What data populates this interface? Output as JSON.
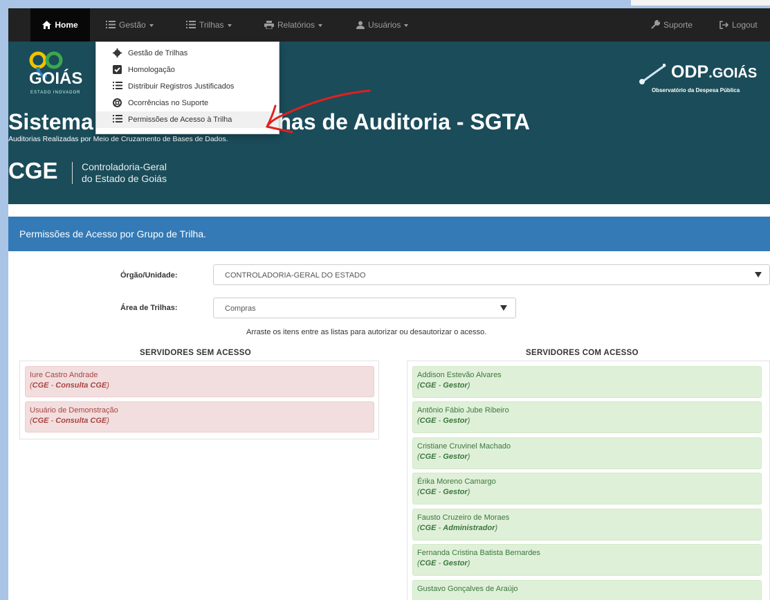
{
  "navbar": {
    "home": "Home",
    "gestao": "Gestão",
    "trilhas": "Trilhas",
    "relatorios": "Relatórios",
    "usuarios": "Usuários",
    "suporte": "Suporte",
    "logout": "Logout"
  },
  "dropdown": {
    "items": [
      {
        "label": "Gestão de Trilhas",
        "icon": "gear-icon"
      },
      {
        "label": "Homologação",
        "icon": "checkbox-icon"
      },
      {
        "label": "Distribuir Registros Justificados",
        "icon": "list-icon"
      },
      {
        "label": "Ocorrências no Suporte",
        "icon": "lifebuoy-icon"
      },
      {
        "label": "Permissões de Acesso à Trilha",
        "icon": "list-icon"
      }
    ]
  },
  "header": {
    "logo_text": "GOIÁS",
    "logo_tagline": "ESTADO INOVADOR",
    "odp_title_main": "ODP",
    "odp_title_suffix": ".GOIÁS",
    "odp_subtitle": "Observatório da Despesa Pública",
    "title": "Sistema de Gestão de Trilhas de Auditoria - SGTA",
    "subtitle": "Auditorias Realizadas por Meio de Cruzamento de Bases de Dados.",
    "cge": "CGE",
    "cge_name_line1": "Controladoria-Geral",
    "cge_name_line2": "do Estado de Goiás"
  },
  "panel": {
    "heading": "Permissões de Acesso por Grupo de Trilha."
  },
  "form": {
    "orgao_label": "Órgão/Unidade:",
    "orgao_value": "CONTROLADORIA-GERAL DO ESTADO",
    "area_label": "Área de Trilhas:",
    "area_value": "Compras",
    "instructions": "Arraste os itens entre as listas para autorizar ou desautorizar o acesso."
  },
  "lists": {
    "sem_acesso_title": "SERVIDORES SEM ACESSO",
    "com_acesso_title": "SERVIDORES COM ACESSO",
    "sem_acesso": [
      {
        "name": "Iure Castro Andrade",
        "org": "CGE",
        "role": "Consulta CGE"
      },
      {
        "name": "Usuário de Demonstração",
        "org": "CGE",
        "role": "Consulta CGE"
      }
    ],
    "com_acesso": [
      {
        "name": "Addison Estevão Alvares",
        "org": "CGE",
        "role": "Gestor"
      },
      {
        "name": "Antônio Fábio Jube Ribeiro",
        "org": "CGE",
        "role": "Gestor"
      },
      {
        "name": "Cristiane Cruvinel Machado",
        "org": "CGE",
        "role": "Gestor"
      },
      {
        "name": "Érika Moreno Camargo",
        "org": "CGE",
        "role": "Gestor"
      },
      {
        "name": "Fausto Cruzeiro de Moraes",
        "org": "CGE",
        "role": "Administrador"
      },
      {
        "name": "Fernanda Cristina Batista Bernardes",
        "org": "CGE",
        "role": "Gestor"
      },
      {
        "name": "Gustavo Gonçalves de Araújo",
        "org": "",
        "role": ""
      }
    ]
  },
  "colors": {
    "navbar": "#222222",
    "header": "#1b4c5a",
    "panel_heading": "#337ab7",
    "card_red": "#f2dede",
    "card_green": "#dff0d8",
    "annotation_arrow": "#e02020"
  }
}
